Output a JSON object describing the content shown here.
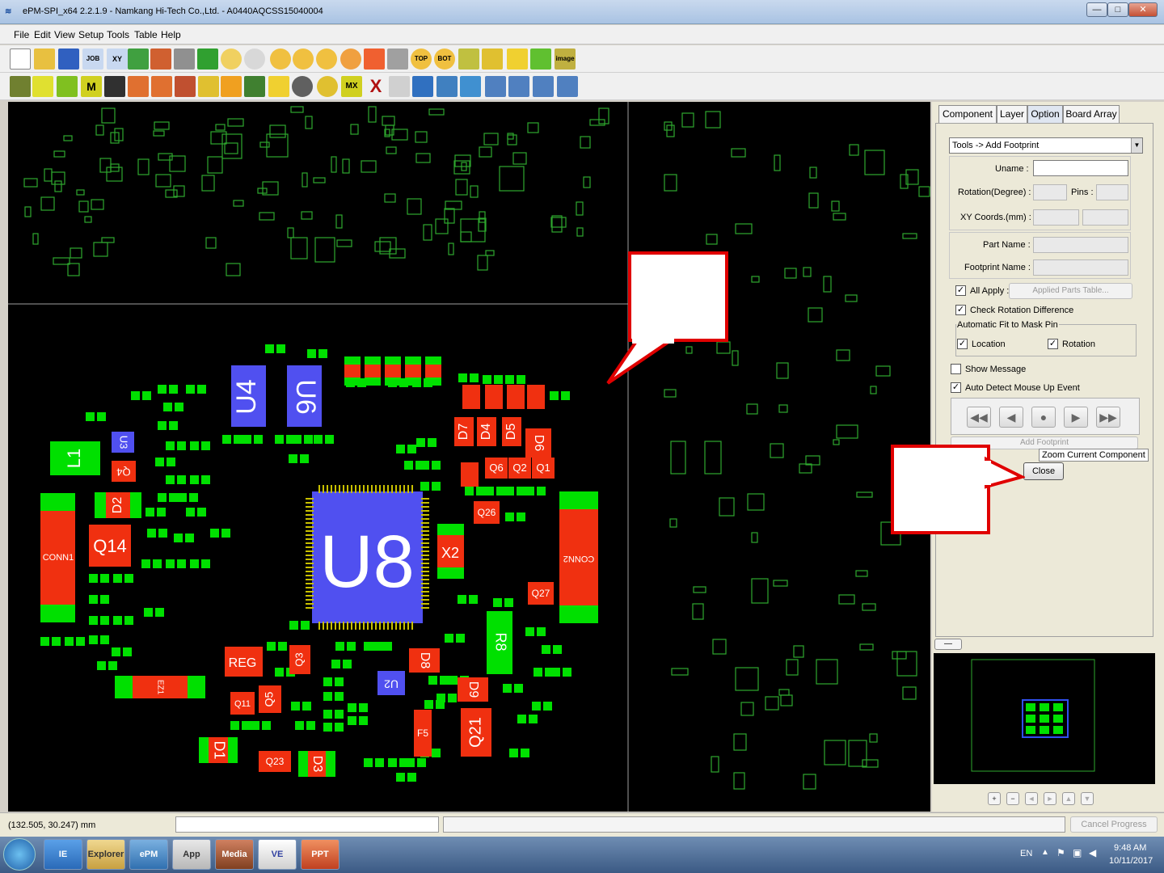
{
  "window": {
    "title": "ePM-SPI_x64 2.2.1.9 - Namkang Hi-Tech Co.,Ltd. - A0440AQCSS15040004",
    "minimize_label": "—",
    "maximize_label": "□",
    "close_label": "✕"
  },
  "menu": {
    "items": [
      {
        "label": "File"
      },
      {
        "label": "Edit"
      },
      {
        "label": "View"
      },
      {
        "label": "Setup"
      },
      {
        "label": "Tools"
      },
      {
        "label": "Table"
      },
      {
        "label": "Help"
      }
    ]
  },
  "toolbar1": {
    "icons": [
      "new-file-icon",
      "open-folder-icon",
      "save-icon",
      "job-icon",
      "xy-icon",
      "ge-icon",
      "export-icon",
      "barcode-icon",
      "grid-icon",
      "undo-icon",
      "redo-icon",
      "zoom-in-icon",
      "zoom-fit-icon",
      "zoom-out-icon",
      "zoom-area-icon",
      "layers-icon",
      "measure-icon",
      "top-icon",
      "bot-icon",
      "pad-icon",
      "component-icon",
      "light-icon",
      "group-icon",
      "image-icon"
    ],
    "labels": {
      "job": "JOB",
      "xy": "XY",
      "top": "TOP",
      "bot": "BOT",
      "image": "image"
    }
  },
  "toolbar2": {
    "icons": [
      "pen-icon",
      "cut-icon",
      "chip-icon",
      "m-icon",
      "x-chip-icon",
      "align-icon",
      "align2-icon",
      "align3-icon",
      "move-icon",
      "rotate-icon",
      "split-icon",
      "merge-icon",
      "target-icon",
      "gear-icon",
      "radiation-icon",
      "mx-icon",
      "delete-x-icon",
      "link-icon",
      "chain-icon",
      "table-icon",
      "copy-icon",
      "swap-icon",
      "sort-icon",
      "export-table-icon",
      "chart-icon"
    ],
    "labels": {
      "m": "M",
      "mx": "MX",
      "x": "X"
    }
  },
  "canvas": {
    "components": {
      "u8": "U8",
      "u4": "U4",
      "u6": "U6",
      "l1": "L1",
      "d2": "D2",
      "q14": "Q14",
      "conn1": "CONN1",
      "conn2": "CONN2",
      "x2": "X2",
      "reg": "REG",
      "q5": "Q5",
      "q11": "Q11",
      "d1": "D1",
      "q23": "Q23",
      "d3": "D3",
      "u2": "U2",
      "d8": "D8",
      "d9": "D9",
      "q21": "Q21",
      "f5": "F5",
      "q26": "Q26",
      "q27": "Q27",
      "r8": "R8",
      "d7": "D7",
      "d4": "D4",
      "d5": "D5",
      "d6": "D6",
      "q6": "Q6",
      "q2": "Q2",
      "q1": "Q1",
      "q4": "Q4",
      "u3": "U3",
      "ez": "EZ1",
      "q3": "Q3"
    }
  },
  "panel": {
    "tabs": [
      {
        "label": "Component"
      },
      {
        "label": "Layer"
      },
      {
        "label": "Option"
      },
      {
        "label": "Board Array"
      }
    ],
    "active_tab": "Option",
    "mode_select": "Tools -> Add Footprint",
    "uname_label": "Uname :",
    "uname_value": "",
    "rotation_label": "Rotation(Degree) :",
    "pins_label": "Pins :",
    "xy_label": "XY Coords.(mm) :",
    "partname_label": "Part Name :",
    "footprint_label": "Footprint Name :",
    "all_apply_label": "All Apply :",
    "all_apply_checked": true,
    "applied_parts_button": "Applied Parts Table...",
    "check_rotation_label": "Check Rotation Difference",
    "check_rotation_checked": true,
    "autofit_group_label": "Automatic Fit to Mask Pin",
    "location_label": "Location",
    "location_checked": true,
    "rotation_chk_label": "Rotation",
    "rotation_chk_checked": true,
    "show_message_label": "Show Message",
    "show_message_checked": false,
    "auto_detect_label": "Auto Detect Mouse Up Event",
    "auto_detect_checked": true,
    "add_footprint_button": "Add Footprint",
    "close_button": "Close",
    "tooltip": "Zoom Current Component",
    "collapse_label": "—",
    "minimap_controls": [
      "+",
      "−",
      "◄",
      "►",
      "▲",
      "▼"
    ]
  },
  "status": {
    "coords": "(132.505, 30.247) mm",
    "cancel_progress": "Cancel Progress"
  },
  "taskbar": {
    "items": [
      "IE",
      "Explorer",
      "ePM",
      "App",
      "Media",
      "VE",
      "PPT"
    ],
    "lang": "EN",
    "time": "9:48 AM",
    "date": "10/11/2017"
  },
  "colors": {
    "pad_green": "#00e000",
    "pad_red": "#f03010",
    "chip_blue": "#5050f0",
    "outline_green": "#2ea82e",
    "callout_red": "#e00000"
  }
}
